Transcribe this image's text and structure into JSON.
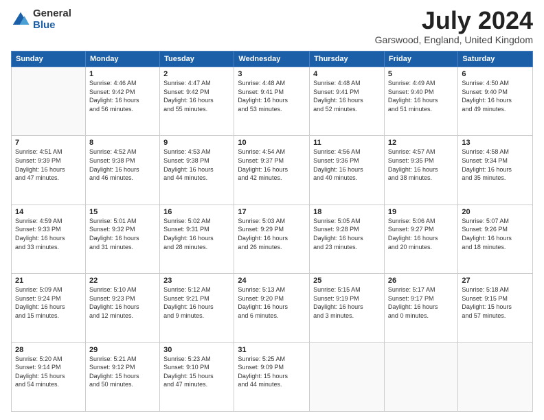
{
  "header": {
    "logo_general": "General",
    "logo_blue": "Blue",
    "month_title": "July 2024",
    "location": "Garswood, England, United Kingdom"
  },
  "days": [
    "Sunday",
    "Monday",
    "Tuesday",
    "Wednesday",
    "Thursday",
    "Friday",
    "Saturday"
  ],
  "weeks": [
    [
      {
        "date": "",
        "info": ""
      },
      {
        "date": "1",
        "info": "Sunrise: 4:46 AM\nSunset: 9:42 PM\nDaylight: 16 hours\nand 56 minutes."
      },
      {
        "date": "2",
        "info": "Sunrise: 4:47 AM\nSunset: 9:42 PM\nDaylight: 16 hours\nand 55 minutes."
      },
      {
        "date": "3",
        "info": "Sunrise: 4:48 AM\nSunset: 9:41 PM\nDaylight: 16 hours\nand 53 minutes."
      },
      {
        "date": "4",
        "info": "Sunrise: 4:48 AM\nSunset: 9:41 PM\nDaylight: 16 hours\nand 52 minutes."
      },
      {
        "date": "5",
        "info": "Sunrise: 4:49 AM\nSunset: 9:40 PM\nDaylight: 16 hours\nand 51 minutes."
      },
      {
        "date": "6",
        "info": "Sunrise: 4:50 AM\nSunset: 9:40 PM\nDaylight: 16 hours\nand 49 minutes."
      }
    ],
    [
      {
        "date": "7",
        "info": "Sunrise: 4:51 AM\nSunset: 9:39 PM\nDaylight: 16 hours\nand 47 minutes."
      },
      {
        "date": "8",
        "info": "Sunrise: 4:52 AM\nSunset: 9:38 PM\nDaylight: 16 hours\nand 46 minutes."
      },
      {
        "date": "9",
        "info": "Sunrise: 4:53 AM\nSunset: 9:38 PM\nDaylight: 16 hours\nand 44 minutes."
      },
      {
        "date": "10",
        "info": "Sunrise: 4:54 AM\nSunset: 9:37 PM\nDaylight: 16 hours\nand 42 minutes."
      },
      {
        "date": "11",
        "info": "Sunrise: 4:56 AM\nSunset: 9:36 PM\nDaylight: 16 hours\nand 40 minutes."
      },
      {
        "date": "12",
        "info": "Sunrise: 4:57 AM\nSunset: 9:35 PM\nDaylight: 16 hours\nand 38 minutes."
      },
      {
        "date": "13",
        "info": "Sunrise: 4:58 AM\nSunset: 9:34 PM\nDaylight: 16 hours\nand 35 minutes."
      }
    ],
    [
      {
        "date": "14",
        "info": "Sunrise: 4:59 AM\nSunset: 9:33 PM\nDaylight: 16 hours\nand 33 minutes."
      },
      {
        "date": "15",
        "info": "Sunrise: 5:01 AM\nSunset: 9:32 PM\nDaylight: 16 hours\nand 31 minutes."
      },
      {
        "date": "16",
        "info": "Sunrise: 5:02 AM\nSunset: 9:31 PM\nDaylight: 16 hours\nand 28 minutes."
      },
      {
        "date": "17",
        "info": "Sunrise: 5:03 AM\nSunset: 9:29 PM\nDaylight: 16 hours\nand 26 minutes."
      },
      {
        "date": "18",
        "info": "Sunrise: 5:05 AM\nSunset: 9:28 PM\nDaylight: 16 hours\nand 23 minutes."
      },
      {
        "date": "19",
        "info": "Sunrise: 5:06 AM\nSunset: 9:27 PM\nDaylight: 16 hours\nand 20 minutes."
      },
      {
        "date": "20",
        "info": "Sunrise: 5:07 AM\nSunset: 9:26 PM\nDaylight: 16 hours\nand 18 minutes."
      }
    ],
    [
      {
        "date": "21",
        "info": "Sunrise: 5:09 AM\nSunset: 9:24 PM\nDaylight: 16 hours\nand 15 minutes."
      },
      {
        "date": "22",
        "info": "Sunrise: 5:10 AM\nSunset: 9:23 PM\nDaylight: 16 hours\nand 12 minutes."
      },
      {
        "date": "23",
        "info": "Sunrise: 5:12 AM\nSunset: 9:21 PM\nDaylight: 16 hours\nand 9 minutes."
      },
      {
        "date": "24",
        "info": "Sunrise: 5:13 AM\nSunset: 9:20 PM\nDaylight: 16 hours\nand 6 minutes."
      },
      {
        "date": "25",
        "info": "Sunrise: 5:15 AM\nSunset: 9:19 PM\nDaylight: 16 hours\nand 3 minutes."
      },
      {
        "date": "26",
        "info": "Sunrise: 5:17 AM\nSunset: 9:17 PM\nDaylight: 16 hours\nand 0 minutes."
      },
      {
        "date": "27",
        "info": "Sunrise: 5:18 AM\nSunset: 9:15 PM\nDaylight: 15 hours\nand 57 minutes."
      }
    ],
    [
      {
        "date": "28",
        "info": "Sunrise: 5:20 AM\nSunset: 9:14 PM\nDaylight: 15 hours\nand 54 minutes."
      },
      {
        "date": "29",
        "info": "Sunrise: 5:21 AM\nSunset: 9:12 PM\nDaylight: 15 hours\nand 50 minutes."
      },
      {
        "date": "30",
        "info": "Sunrise: 5:23 AM\nSunset: 9:10 PM\nDaylight: 15 hours\nand 47 minutes."
      },
      {
        "date": "31",
        "info": "Sunrise: 5:25 AM\nSunset: 9:09 PM\nDaylight: 15 hours\nand 44 minutes."
      },
      {
        "date": "",
        "info": ""
      },
      {
        "date": "",
        "info": ""
      },
      {
        "date": "",
        "info": ""
      }
    ]
  ]
}
